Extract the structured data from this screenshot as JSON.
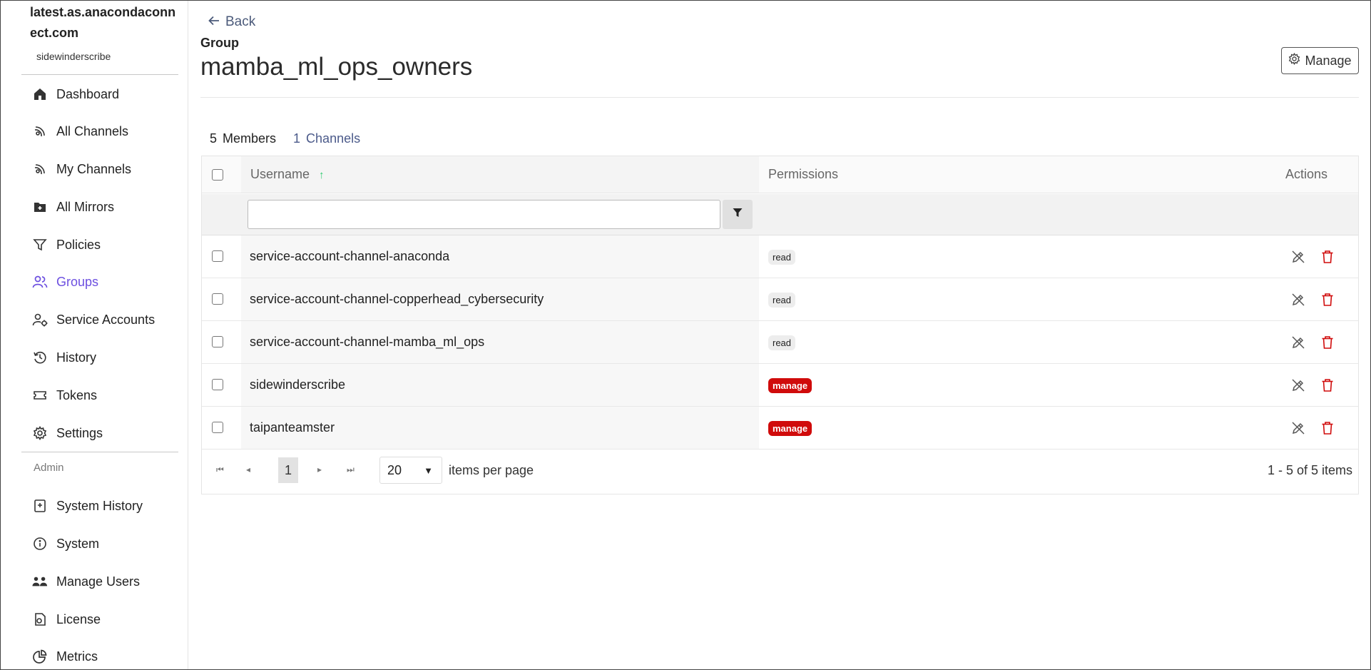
{
  "sidebar": {
    "host": "latest.as.anacondaconnect.com",
    "username": "sidewinderscribe",
    "items": [
      {
        "label": "Dashboard",
        "icon": "home-icon"
      },
      {
        "label": "All Channels",
        "icon": "channel-icon"
      },
      {
        "label": "My Channels",
        "icon": "channel-icon"
      },
      {
        "label": "All Mirrors",
        "icon": "mirror-icon"
      },
      {
        "label": "Policies",
        "icon": "filter-icon"
      },
      {
        "label": "Groups",
        "icon": "users-icon",
        "active": true
      },
      {
        "label": "Service Accounts",
        "icon": "service-account-icon"
      },
      {
        "label": "History",
        "icon": "history-icon"
      },
      {
        "label": "Tokens",
        "icon": "ticket-icon"
      },
      {
        "label": "Settings",
        "icon": "gear-icon"
      }
    ],
    "admin_label": "Admin",
    "admin_items": [
      {
        "label": "System History",
        "icon": "system-history-icon"
      },
      {
        "label": "System",
        "icon": "info-icon"
      },
      {
        "label": "Manage Users",
        "icon": "manage-users-icon"
      },
      {
        "label": "License",
        "icon": "license-icon"
      },
      {
        "label": "Metrics",
        "icon": "pie-chart-icon"
      }
    ]
  },
  "header": {
    "back_label": "Back",
    "breadcrumb": "Group",
    "title": "mamba_ml_ops_owners",
    "manage_label": "Manage"
  },
  "tabs": [
    {
      "count": "5",
      "label": "Members",
      "active": true
    },
    {
      "count": "1",
      "label": "Channels",
      "active": false
    }
  ],
  "table": {
    "columns": {
      "username": "Username",
      "permissions": "Permissions",
      "actions": "Actions"
    },
    "sort_indicator": "↑",
    "filter_value": "",
    "rows": [
      {
        "username": "service-account-channel-anaconda",
        "permission": "read"
      },
      {
        "username": "service-account-channel-copperhead_cybersecurity",
        "permission": "read"
      },
      {
        "username": "service-account-channel-mamba_ml_ops",
        "permission": "read"
      },
      {
        "username": "sidewinderscribe",
        "permission": "manage"
      },
      {
        "username": "taipanteamster",
        "permission": "manage"
      }
    ]
  },
  "pager": {
    "current_page": "1",
    "page_size": "20",
    "items_per_page_label": "items per page",
    "info": "1 - 5 of 5 items"
  },
  "colors": {
    "accent": "#6c4fe0",
    "danger": "#d00b0b",
    "sort_arrow": "#2ecc71"
  }
}
